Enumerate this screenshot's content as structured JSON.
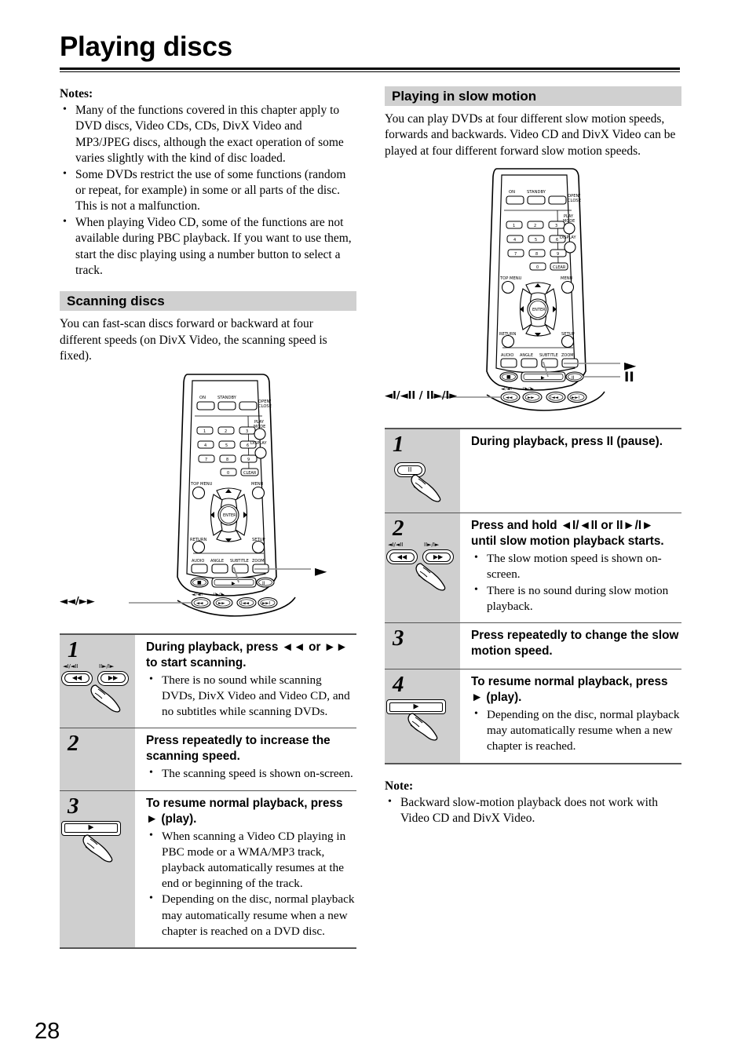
{
  "document": {
    "title": "Playing discs",
    "page_number": "28"
  },
  "left_column": {
    "notes_label": "Notes:",
    "notes": [
      "Many of the functions covered in this chapter apply to DVD discs, Video CDs, CDs, DivX Video and MP3/JPEG discs, although the exact operation of some varies slightly with the kind of disc loaded.",
      "Some DVDs restrict the use of some functions (random or repeat, for example) in some or all parts of the disc. This is not a malfunction.",
      "When playing Video CD, some of the functions are not available during PBC playback. If you want to use them, start the disc playing using a number button to select a track."
    ],
    "section": {
      "heading": "Scanning discs",
      "intro": "You can fast-scan discs forward or backward at four different speeds (on DivX Video, the scanning speed is fixed)."
    },
    "remote_callouts": [
      {
        "label": "◄◄/►►",
        "name": "scan-buttons-callout"
      },
      {
        "label": "►",
        "name": "play-button-callout"
      }
    ],
    "steps": [
      {
        "number": "1",
        "heading": "During playback, press ◄◄ or ►► to start scanning.",
        "bullets": [
          "There is no sound while scanning DVDs, DivX Video and Video CD, and no subtitles while scanning DVDs."
        ],
        "art": "scan-buttons",
        "btn_labels": {
          "left": "◄I/◄II",
          "right": "II►/I►"
        }
      },
      {
        "number": "2",
        "heading": "Press repeatedly to increase the scanning speed.",
        "bullets": [
          "The scanning speed is shown on-screen."
        ],
        "art": "none"
      },
      {
        "number": "3",
        "heading": "To resume normal playback, press ► (play).",
        "bullets": [
          "When scanning a Video CD playing in PBC mode or a WMA/MP3 track, playback automatically resumes at the end or beginning of the track.",
          "Depending on the disc, normal playback may automatically resume when a new chapter is reached on a DVD disc."
        ],
        "art": "play-bar"
      }
    ]
  },
  "right_column": {
    "section": {
      "heading": "Playing in slow motion",
      "intro": "You can play DVDs at four different slow motion speeds, forwards and backwards. Video CD and DivX Video can be played at four different forward slow motion speeds."
    },
    "remote_callouts": [
      {
        "label": "►",
        "name": "play-button-callout"
      },
      {
        "label": "II",
        "name": "pause-button-callout"
      },
      {
        "label": "◄I/◄II / II►/I►",
        "name": "slow-motion-buttons-callout"
      }
    ],
    "steps": [
      {
        "number": "1",
        "heading": "During playback, press II (pause).",
        "bullets": [],
        "art": "pause-button"
      },
      {
        "number": "2",
        "heading": "Press and hold ◄I/◄II or II►/I► until slow motion playback starts.",
        "bullets": [
          "The slow motion speed is shown on-screen.",
          "There is no sound during slow motion playback."
        ],
        "art": "scan-buttons",
        "btn_labels": {
          "left": "◄I/◄II",
          "right": "II►/I►"
        }
      },
      {
        "number": "3",
        "heading": "Press repeatedly to change the slow motion speed.",
        "bullets": [],
        "art": "none"
      },
      {
        "number": "4",
        "heading": "To resume normal playback, press ► (play).",
        "bullets": [
          "Depending on the disc, normal playback may automatically resume when a new chapter is reached."
        ],
        "art": "play-bar"
      }
    ],
    "note_label": "Note:",
    "notes": [
      "Backward slow-motion playback does not work with Video CD and DivX Video."
    ]
  },
  "remote_control": {
    "power_row": [
      {
        "label": "ON"
      },
      {
        "label": "STANDBY"
      },
      {
        "label": "OPEN/\nCLOSE"
      }
    ],
    "numeric_keys": [
      "1",
      "2",
      "3",
      "4",
      "5",
      "6",
      "7",
      "8",
      "9",
      "0",
      "CLEAR"
    ],
    "side_keys": [
      "PLAY MODE",
      "DISPLAY"
    ],
    "nav_labels": [
      "TOP MENU",
      "MENU",
      "RETURN",
      "SETUP",
      "ENTER"
    ],
    "function_keys": [
      "AUDIO",
      "ANGLE",
      "SUBTITLE",
      "ZOOM"
    ],
    "transport_keys": [
      "stop",
      "play",
      "pause",
      "scan-back",
      "scan-forward",
      "prev",
      "next"
    ]
  }
}
